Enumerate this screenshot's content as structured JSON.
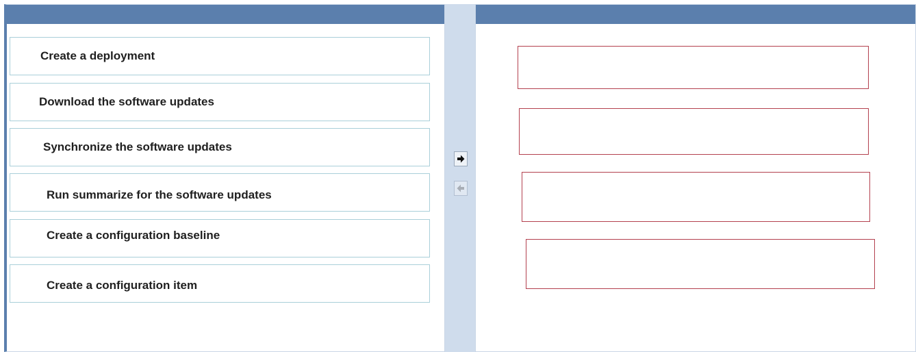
{
  "source_list": {
    "items": [
      {
        "label": "Create a deployment"
      },
      {
        "label": "Download the software updates"
      },
      {
        "label": "Synchronize the software updates"
      },
      {
        "label": "Run summarize for the software updates"
      },
      {
        "label": "Create a configuration baseline"
      },
      {
        "label": "Create a configuration item"
      }
    ]
  },
  "target_list": {
    "slot_count": 4
  },
  "controls": {
    "move_right_icon": "arrow-right-icon",
    "move_left_icon": "arrow-left-icon"
  },
  "colors": {
    "header": "#5b7fad",
    "gutter": "#cfdcec",
    "source_border": "#a9cfd9",
    "target_border": "#b3404e"
  }
}
